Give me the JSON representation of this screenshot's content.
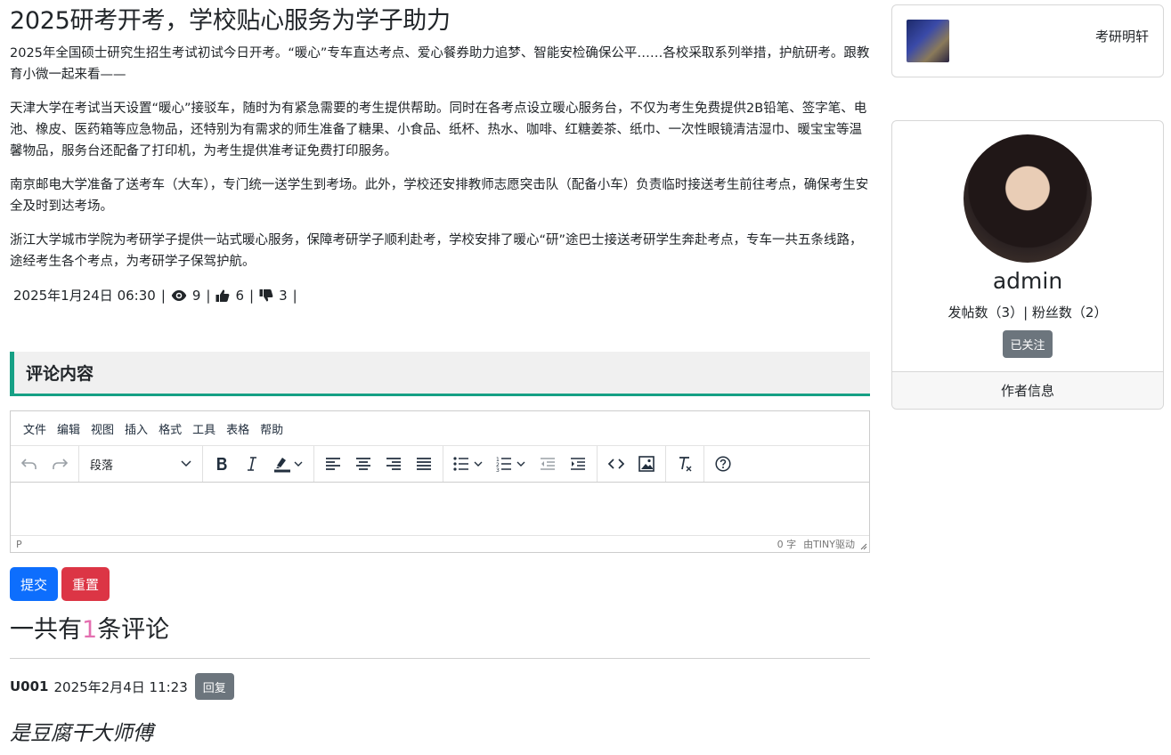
{
  "article": {
    "title": "2025研考开考，学校贴心服务为学子助力",
    "paragraphs": [
      "2025年全国硕士研究生招生考试初试今日开考。“暖心”专车直达考点、爱心餐券助力追梦、智能安检确保公平……各校采取系列举措，护航研考。跟教育小微一起来看——",
      "天津大学在考试当天设置“暖心”接驳车，随时为有紧急需要的考生提供帮助。同时在各考点设立暖心服务台，不仅为考生免费提供2B铅笔、签字笔、电池、橡皮、医药箱等应急物品，还特别为有需求的师生准备了糖果、小食品、纸杯、热水、咖啡、红糖姜茶、纸巾、一次性眼镜清洁湿巾、暖宝宝等温馨物品，服务台还配备了打印机，为考生提供准考证免费打印服务。",
      "南京邮电大学准备了送考车（大车），专门统一送学生到考场。此外，学校还安排教师志愿突击队（配备小车）负责临时接送考生前往考点，确保考生安全及时到达考场。",
      "浙江大学城市学院为考研学子提供一站式暖心服务，保障考研学子顺利赴考，学校安排了暖心“研”途巴士接送考研学生奔赴考点，专车一共五条线路，途经考生各个考点，为考研学子保驾护航。"
    ],
    "datetime": "2025年1月24日 06:30",
    "views": "9",
    "likes": "6",
    "dislikes": "3",
    "sep": "|"
  },
  "comments_section": {
    "heading": "评论内容",
    "editor": {
      "menu": [
        "文件",
        "编辑",
        "视图",
        "插入",
        "格式",
        "工具",
        "表格",
        "帮助"
      ],
      "block_format": "段落",
      "status_path": "P",
      "word_count": "0 字",
      "branding": "由TINY驱动"
    },
    "submit_label": "提交",
    "reset_label": "重置",
    "count_prefix": "一共有",
    "count": "1",
    "count_suffix": "条评论",
    "items": [
      {
        "user": "U001",
        "time": "2025年2月4日 11:23",
        "reply_label": "回复",
        "text": "是豆腐干大师傅"
      }
    ]
  },
  "sidebar": {
    "blog": {
      "name": "考研明轩"
    },
    "author": {
      "name": "admin",
      "stats": "发帖数（3）| 粉丝数（2）",
      "follow_label": "已关注",
      "footer": "作者信息"
    }
  },
  "colors": {
    "accent": "#16a085",
    "primary": "#0d6efd",
    "danger": "#dc3545",
    "secondary": "#6c757d",
    "count_highlight": "#e46fb0"
  }
}
